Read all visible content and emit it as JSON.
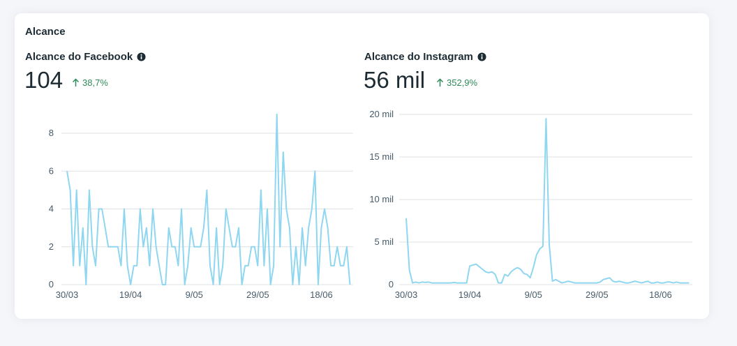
{
  "section": {
    "title": "Alcance"
  },
  "facebook": {
    "title": "Alcance do Facebook",
    "value": "104",
    "delta": "38,7%"
  },
  "instagram": {
    "title": "Alcance do Instagram",
    "value": "56 mil",
    "delta": "352,9%"
  },
  "colors": {
    "line": "#8fd6f0",
    "positive": "#2f8a5b",
    "text": "#1c2b33"
  },
  "icons": {
    "info": "info-icon",
    "up": "arrow-up-icon"
  },
  "chart_data": [
    {
      "type": "line",
      "name": "facebook-reach",
      "ylim": [
        0,
        9
      ],
      "yticks": [
        0,
        2,
        4,
        6,
        8
      ],
      "ytick_labels": [
        "0",
        "2",
        "4",
        "6",
        "8"
      ],
      "xlim": [
        0,
        90
      ],
      "xticks": [
        0,
        20,
        40,
        60,
        80
      ],
      "xtick_labels": [
        "30/03",
        "19/04",
        "9/05",
        "29/05",
        "18/06"
      ],
      "grid": true,
      "series": [
        {
          "values": [
            6,
            5,
            1,
            5,
            1,
            3,
            0,
            5,
            2,
            1,
            4,
            4,
            3,
            2,
            2,
            2,
            2,
            1,
            4,
            1,
            0,
            1,
            1,
            4,
            2,
            3,
            1,
            4,
            2,
            1,
            0,
            0,
            3,
            2,
            2,
            1,
            4,
            0,
            1,
            3,
            2,
            2,
            2,
            3,
            5,
            1,
            0,
            3,
            0,
            1,
            4,
            3,
            2,
            2,
            3,
            0,
            1,
            1,
            2,
            2,
            1,
            5,
            1,
            4,
            0,
            1,
            9,
            2,
            7,
            4,
            3,
            0,
            2,
            0,
            3,
            1,
            3,
            4,
            6,
            0,
            3,
            4,
            3,
            1,
            1,
            2,
            1,
            1,
            2,
            0
          ]
        }
      ]
    },
    {
      "type": "line",
      "name": "instagram-reach",
      "ylim": [
        0,
        20000
      ],
      "yticks": [
        0,
        5000,
        10000,
        15000,
        20000
      ],
      "ytick_labels": [
        "0",
        "5 mil",
        "10 mil",
        "15 mil",
        "20 mil"
      ],
      "xlim": [
        0,
        90
      ],
      "xticks": [
        0,
        20,
        40,
        60,
        80
      ],
      "xtick_labels": [
        "30/03",
        "19/04",
        "9/05",
        "29/05",
        "18/06"
      ],
      "grid": true,
      "series": [
        {
          "values": [
            7800,
            1700,
            200,
            300,
            200,
            300,
            250,
            300,
            200,
            200,
            200,
            200,
            200,
            200,
            200,
            250,
            200,
            200,
            200,
            200,
            2200,
            2300,
            2400,
            2100,
            1800,
            1500,
            1400,
            1500,
            1200,
            200,
            200,
            1200,
            1000,
            1500,
            1800,
            2000,
            1800,
            1300,
            1200,
            800,
            2000,
            3500,
            4200,
            4500,
            19500,
            4700,
            400,
            600,
            400,
            200,
            300,
            400,
            300,
            200,
            200,
            200,
            200,
            200,
            200,
            200,
            200,
            300,
            600,
            700,
            800,
            400,
            300,
            400,
            300,
            200,
            200,
            300,
            400,
            300,
            200,
            300,
            400,
            200,
            200,
            300,
            200,
            200,
            300,
            300,
            200,
            300,
            200,
            200,
            200,
            200
          ]
        }
      ]
    }
  ]
}
